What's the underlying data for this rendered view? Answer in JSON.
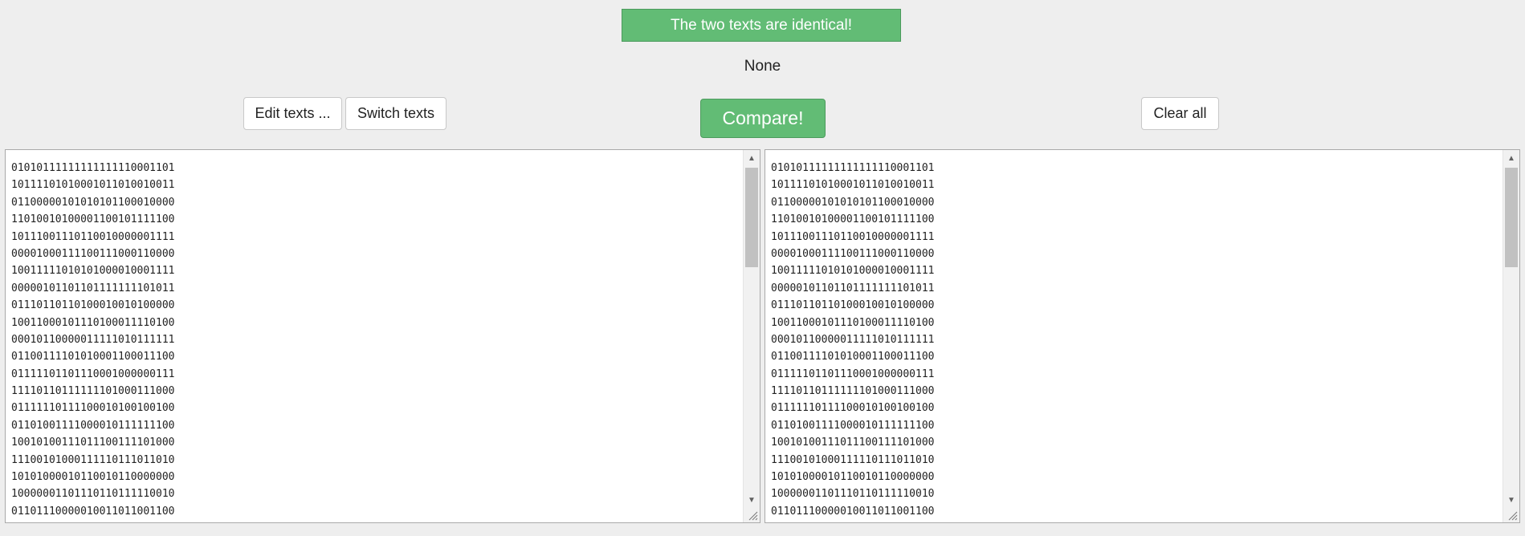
{
  "banner": {
    "text": "The two texts are identical!"
  },
  "status": {
    "text": "None"
  },
  "toolbar": {
    "edit_label": "Edit texts ...",
    "switch_label": "Switch texts",
    "compare_label": "Compare!",
    "clear_label": "Clear all"
  },
  "colors": {
    "accent": "#62bc75",
    "background": "#eeeeee"
  },
  "icons": {
    "scroll_up": "chevron-up-icon",
    "scroll_down": "chevron-down-icon",
    "resize": "resize-grip-icon"
  },
  "left_text": {
    "lines": [
      "01010111111111111110001101",
      "10111101010001011010010011",
      "01100000101010101100010000",
      "11010010100001100101111100",
      "10111001110110010000001111",
      "00001000111100111000110000",
      "10011111010101000010001111",
      "00000101101101111111101011",
      "01110110110100010010100000",
      "10011000101110100011110100",
      "00010110000011111010111111",
      "01100111101010001100011100",
      "01111101101110001000000111",
      "11110110111111101000111000",
      "01111110111100010100100100",
      "01101001111000010111111100",
      "10010100111011100111101000",
      "11100101000111110111011010",
      "10101000010110010110000000",
      "10000001101110110111110010",
      "01101110000010011011001100"
    ]
  },
  "right_text": {
    "lines": [
      "01010111111111111110001101",
      "10111101010001011010010011",
      "01100000101010101100010000",
      "11010010100001100101111100",
      "10111001110110010000001111",
      "00001000111100111000110000",
      "10011111010101000010001111",
      "00000101101101111111101011",
      "01110110110100010010100000",
      "10011000101110100011110100",
      "00010110000011111010111111",
      "01100111101010001100011100",
      "01111101101110001000000111",
      "11110110111111101000111000",
      "01111110111100010100100100",
      "01101001111000010111111100",
      "10010100111011100111101000",
      "11100101000111110111011010",
      "10101000010110010110000000",
      "10000001101110110111110010",
      "01101110000010011011001100"
    ]
  }
}
